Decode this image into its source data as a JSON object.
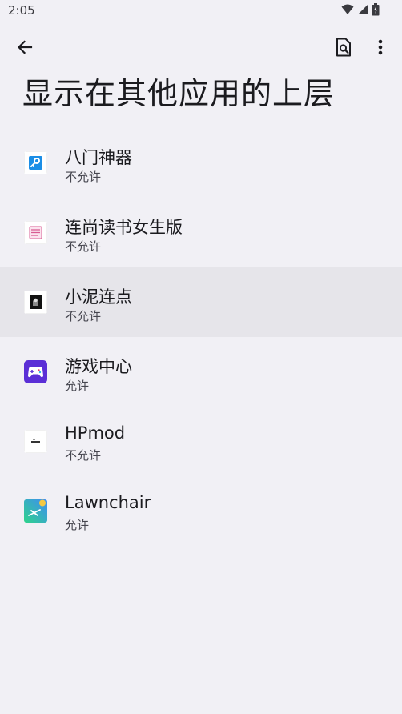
{
  "status_bar": {
    "time": "2:05",
    "icons": [
      "wifi-icon",
      "signal-icon",
      "battery-icon"
    ]
  },
  "toolbar": {
    "back_icon": "arrow-left-icon",
    "search_icon": "search-in-page-icon",
    "more_icon": "more-vert-icon"
  },
  "page": {
    "title": "显示在其他应用的上层"
  },
  "apps": [
    {
      "name": "八门神器",
      "status": "不允许",
      "icon": "bamen-app-icon"
    },
    {
      "name": "连尚读书女生版",
      "status": "不允许",
      "icon": "lianshang-app-icon"
    },
    {
      "name": "小泥连点",
      "status": "不允许",
      "icon": "xiaoni-app-icon",
      "highlighted": true
    },
    {
      "name": "游戏中心",
      "status": "允许",
      "icon": "game-center-app-icon"
    },
    {
      "name": "HPmod",
      "status": "不允许",
      "icon": "hpmod-app-icon"
    },
    {
      "name": "Lawnchair",
      "status": "允许",
      "icon": "lawnchair-app-icon"
    }
  ],
  "colors": {
    "background": "#f1f0f5",
    "highlight": "#e6e5ea",
    "game_center": "#5b2fd6",
    "lawnchair": "#3fa1f5"
  }
}
